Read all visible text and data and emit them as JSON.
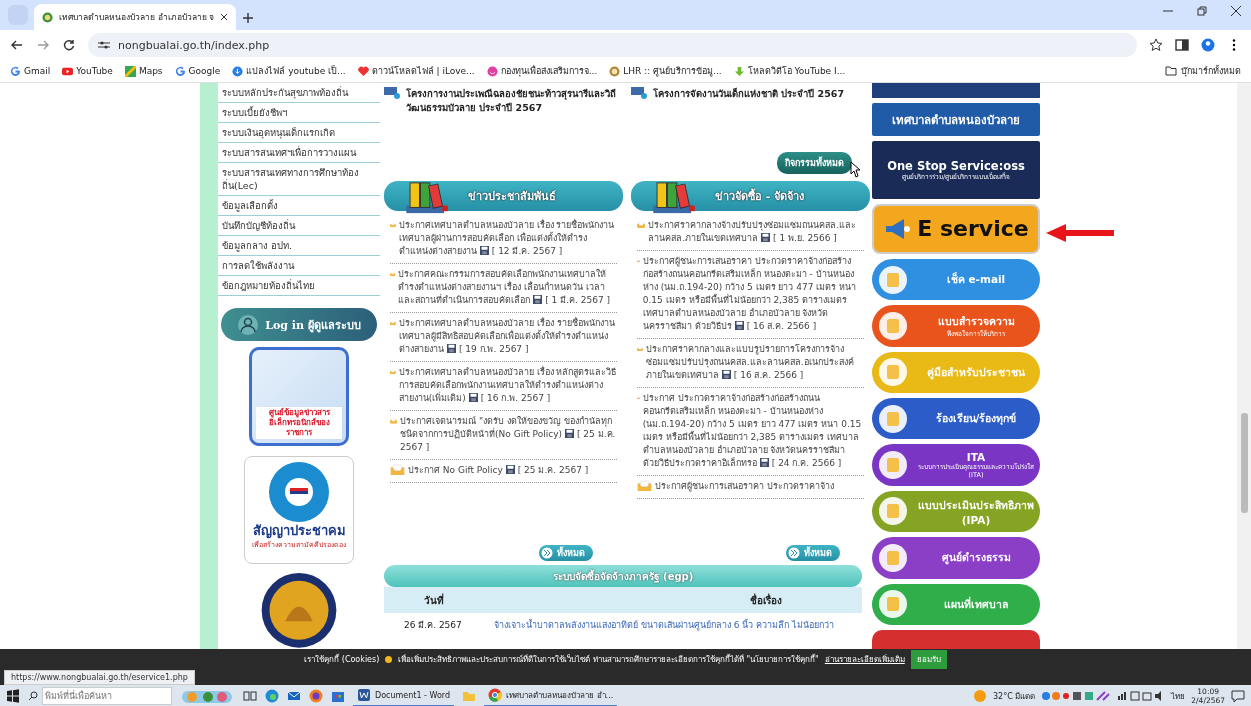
{
  "browser": {
    "tab_title": "เทศบาลตำบลหนองบัวลาย อำเภอบัวลาย จ",
    "url": "nongbualai.go.th/index.php",
    "bookmarks": [
      {
        "label": "Gmail",
        "kind": "g"
      },
      {
        "label": "YouTube",
        "kind": "yt"
      },
      {
        "label": "Maps",
        "kind": "maps"
      },
      {
        "label": "Google",
        "kind": "g"
      },
      {
        "label": "แปลงไฟล์ youtube เป็...",
        "kind": "dl"
      },
      {
        "label": "ดาวน์โหลดไฟล์ | iLove...",
        "kind": "heart"
      },
      {
        "label": "กองทุนเพื่อส่งเสริมการจ...",
        "kind": "smile"
      },
      {
        "label": "LHR :: ศูนย์บริการข้อมู...",
        "kind": "seal"
      },
      {
        "label": "โหลดวิดีโอ YouTube I...",
        "kind": "arrow"
      }
    ],
    "all_bookmarks": "บุ๊กมาร์กทั้งหมด"
  },
  "left_menu": [
    "ระบบหลักประกันสุขภาพท้องถิ่น",
    "ระบบเบี้ยยังชีพฯ",
    "ระบบเงินอุดหนุนเด็กแรกเกิด",
    "ระบบสารสนเทศฯเพื่อการวางแผน",
    "ระบบสารสนเทศทางการศึกษาท้องถิ่น(Lec)",
    "ข้อมูลเลือกตั้ง",
    "บันทึกบัญชีท้องถิ่น",
    "ข้อมูลกลาง อปท.",
    "การลดใช้พลังงาน",
    "ข้อกฎหมายท้องถิ่นไทย"
  ],
  "login_banner": "Log in ผู้ดูแลระบบ",
  "info_center": "ศูนย์ข้อมูลข่าวสารอิเล็กทรอนิกส์ของราชการ",
  "pact": {
    "title": "สัญญาประชาคม",
    "subtitle": "เพื่อสร้างความสามัคคีปรองดอง"
  },
  "projects": [
    "โครงการงานประเพณีฉลองชัยชนะท้าวสุรนารีและวิถีวัฒนธรรมบัวลาย ประจำปี 2567",
    "โครงการจัดงานวันเด็กแห่งชาติ ประจำปี 2567"
  ],
  "activities_button": "กิจกรรมทั้งหมด",
  "news_columns": [
    {
      "title": "ข่าวประชาสัมพันธ์",
      "more": "ทั้งหมด",
      "items": [
        {
          "text": "ประกาศเทศบาลตำบลหนองบัวลาย เรื่อง รายชื่อพนักงานเทศบาลผู้ผ่านการสอบคัดเลือก เพื่อแต่งตั้งให้ดำรงตำแหน่งต่างสายงาน",
          "date": "[ 12 มี.ค. 2567 ]"
        },
        {
          "text": "ประกาศคณะกรรมการสอบคัดเลือกพนักงานเทศบาลให้ดำรงตำแหน่งต่างสายงานฯ เรื่อง เลื่อนกำหนดวัน เวลา และสถานที่ดำเนินการสอบคัดเลือก",
          "date": "[ 1 มี.ค. 2567 ]"
        },
        {
          "text": "ประกาศเทศบาลตำบลหนองบัวลาย เรื่อง รายชื่อพนักงานเทศบาลผู้มีสิทธิสอบคัดเลือกเพื่อแต่งตั้งให้ดำรงตำแหน่งต่างสายงาน",
          "date": "[ 19 ก.พ. 2567 ]"
        },
        {
          "text": "ประกาศเทศบาลตำบลหนองบัวลาย เรื่อง หลักสูตรและวิธีการสอบคัดเลือกพนักงานเทศบาลให้ดำรงตำแหน่งต่างสายงาน(เพิ่มเติม)",
          "date": "[ 16 ก.พ. 2567 ]"
        },
        {
          "text": "ประกาศเจตนารมณ์ \"งดรับ งดให้ของขวัญ ของกำนัลทุกชนิดจากการปฏิบัติหน้าที่(No Gift Policy)",
          "date": "[ 25 ม.ค. 2567 ]"
        },
        {
          "text": "ประกาศ No Gift Policy",
          "date": "[ 25 ม.ค. 2567 ]"
        }
      ]
    },
    {
      "title": "ข่าวจัดซื้อ - จัดจ้าง",
      "more": "ทั้งหมด",
      "items": [
        {
          "text": "ประกาศราคากลางจ้างปรับปรุงซ่อมแซมถนนคสล.และลานคสล.ภายในเขตเทศบาล",
          "date": "[ 1 พ.ย. 2566 ]"
        },
        {
          "text": "ประกาศผู้ชนะการเสนอราคา ประกวดราคาจ้างก่อสร้างก่อสร้างถนนคอนกรีตเสริมเหล็ก หนองตะมา - บ้านหนองห่าง (นม.ถ.194-20) กว้าง 5 เมตร ยาว 477 เมตร หนา 0.15 เมตร หรือมีพื้นที่ไม่น้อยกว่า 2,385 ตารางเมตร เทศบาลตำบลหนองบัวลาย อำเภอบัวลาย จังหวัดนครราชสีมา ด้วยวิธีปร",
          "date": "[ 16 ส.ค. 2566 ]"
        },
        {
          "text": "ประกาศราคากลางและแบบรูปรายการโครงการจ้างซ่อมแซมปรับปรุงถนนคสล.และลานคสล.อเนกประสงค์ภายในเขตเทศบาล",
          "date": "[ 16 ส.ค. 2566 ]"
        },
        {
          "text": "ประกาศ ประกวดราคาจ้างก่อสร้างก่อสร้างถนนคอนกรีตเสริมเหล็ก หนองตะมา - บ้านหนองห่าง (นม.ถ.194-20) กว้าง 5 เมตร ยาว 477 เมตร หนา 0.15 เมตร หรือมีพื้นที่ไม่น้อยกว่า 2,385 ตารางเมตร เทศบาลตำบลหนองบัวลาย อำเภอบัวลาย จังหวัดนครราชสีมา ด้วยวิธีประกวดราคาอิเล็กทรอ",
          "date": "[ 24 ก.ค. 2566 ]"
        },
        {
          "text": "ประกาศผู้ชนะการเสนอราคา ประกวดราคาจ้าง"
        }
      ]
    }
  ],
  "egp": {
    "title": "ระบบจัดซื้อจัดจ้างภาครัฐ (egp)",
    "columns": [
      "วันที่",
      "ชื่อเรื่อง"
    ],
    "rows": [
      [
        "26 มี.ค. 2567",
        "จ้างเจาะน้ำบาดาลพลังงานแสงอาทิตย์ ขนาดเส้นผ่านศูนย์กลาง 6 นิ้ว ความลึก ไม่น้อยกว่า"
      ]
    ]
  },
  "sidebar": [
    {
      "kind": "banner",
      "label": "เทศบาลตำบลหนองบัวลาย",
      "color": "#1f5ba6"
    },
    {
      "kind": "banner",
      "label": "One Stop Service:oss",
      "sublabel": "ศูนย์บริการร่วม/ศูนย์บริการแบบเบ็ดเสร็จ",
      "color": "#1b2b58"
    },
    {
      "kind": "feature",
      "label": "E service",
      "color": "#f3a71e"
    },
    {
      "kind": "pill",
      "label": "เช็ค e-mail",
      "color": "#2f8fe0"
    },
    {
      "kind": "pill",
      "label": "แบบสำรวจความ",
      "sublabel": "พึงพอใจการให้บริการ",
      "color": "#e8541c"
    },
    {
      "kind": "pill",
      "label": "คู่มือสำหรับประชาชน",
      "color": "#e9b916"
    },
    {
      "kind": "pill",
      "label": "ร้องเรียน/ร้องทุกข์",
      "color": "#2b5cc7"
    },
    {
      "kind": "pill",
      "label": "ITA",
      "sublabel": "ระบบการประเมินคุณธรรมและความโปร่งใส (ITA)",
      "color": "#7a35c4"
    },
    {
      "kind": "pill",
      "label": "แบบประเมินประสิทธิภาพ (IPA)",
      "color": "#86a424"
    },
    {
      "kind": "pill",
      "label": "ศูนย์ดำรงธรรม",
      "color": "#8a3fc6"
    },
    {
      "kind": "pill",
      "label": "แผนที่เทศบาล",
      "color": "#2fae4a"
    }
  ],
  "cookie": {
    "title": "เราใช้คุกกี้ (Cookies)",
    "text": "เพื่อเพิ่มประสิทธิภาพและประสบการณ์ที่ดีในการใช้เว็บไซต์ ท่านสามารถศึกษารายละเอียดการใช้คุกกี้ได้ที่ \"นโยบายการใช้คุกกี้\"",
    "link": "อ่านรายละเอียดเพิ่มเติม",
    "accept": "ยอมรับ"
  },
  "status_url": "https://www.nongbualai.go.th/eservice1.php",
  "taskbar": {
    "search_placeholder": "พิมพ์ที่นี่เพื่อค้นหา",
    "apps": [
      {
        "kind": "taskview"
      },
      {
        "kind": "edge"
      },
      {
        "kind": "mail"
      },
      {
        "kind": "firefox"
      },
      {
        "kind": "store"
      },
      {
        "kind": "word",
        "label": "Document1 - Word"
      },
      {
        "kind": "explorer"
      },
      {
        "kind": "chrome",
        "label": "เทศบาลตำบลหนองบัวลาย อำ..."
      }
    ],
    "weather": "32°C มีแดด",
    "language": "ไทย",
    "time": "10:09",
    "date": "2/4/2567"
  }
}
